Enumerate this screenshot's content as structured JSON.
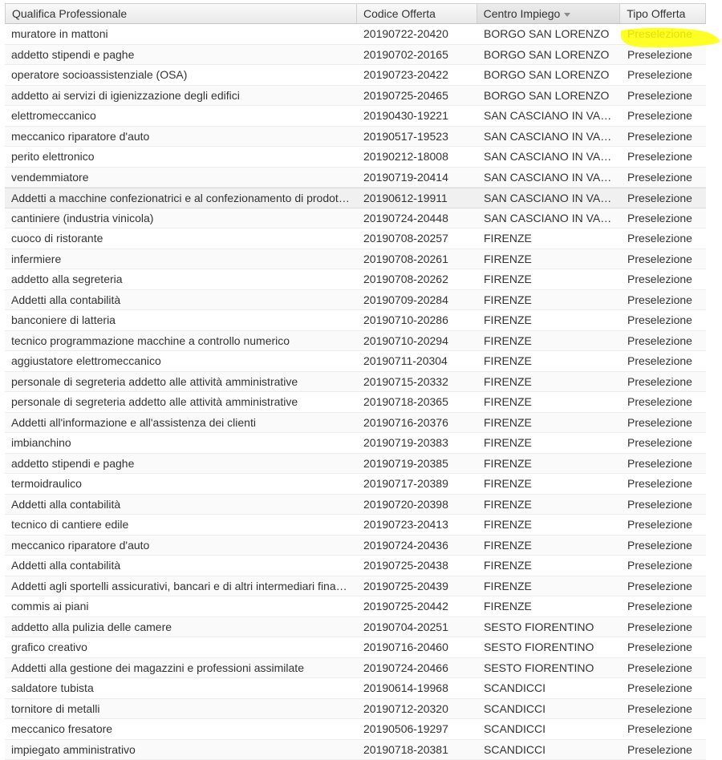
{
  "columns": {
    "qualifica": "Qualifica Professionale",
    "codice": "Codice Offerta",
    "centro": "Centro Impiego",
    "tipo": "Tipo Offerta"
  },
  "sort_column": "Centro Impiego",
  "highlight_color": "#ffff00",
  "rows": [
    {
      "qualifica": "muratore in mattoni",
      "codice": "20190722-20420",
      "centro": "BORGO SAN LORENZO",
      "tipo": "Preselezione"
    },
    {
      "qualifica": "addetto stipendi e paghe",
      "codice": "20190702-20165",
      "centro": "BORGO SAN LORENZO",
      "tipo": "Preselezione"
    },
    {
      "qualifica": "operatore socioassistenziale (OSA)",
      "codice": "20190723-20422",
      "centro": "BORGO SAN LORENZO",
      "tipo": "Preselezione"
    },
    {
      "qualifica": "addetto ai servizi di igienizzazione degli edifici",
      "codice": "20190725-20465",
      "centro": "BORGO SAN LORENZO",
      "tipo": "Preselezione"
    },
    {
      "qualifica": "elettromeccanico",
      "codice": "20190430-19221",
      "centro": "SAN CASCIANO IN VAL…",
      "tipo": "Preselezione"
    },
    {
      "qualifica": "meccanico riparatore d'auto",
      "codice": "20190517-19523",
      "centro": "SAN CASCIANO IN VAL…",
      "tipo": "Preselezione"
    },
    {
      "qualifica": "perito elettronico",
      "codice": "20190212-18008",
      "centro": "SAN CASCIANO IN VAL…",
      "tipo": "Preselezione"
    },
    {
      "qualifica": "vendemmiatore",
      "codice": "20190719-20414",
      "centro": "SAN CASCIANO IN VAL…",
      "tipo": "Preselezione"
    },
    {
      "qualifica": "Addetti a macchine confezionatrici e al confezionamento di prodotti …",
      "codice": "20190612-19911",
      "centro": "SAN CASCIANO IN VAL…",
      "tipo": "Preselezione"
    },
    {
      "qualifica": "cantiniere (industria vinicola)",
      "codice": "20190724-20448",
      "centro": "SAN CASCIANO IN VAL…",
      "tipo": "Preselezione"
    },
    {
      "qualifica": "cuoco di ristorante",
      "codice": "20190708-20257",
      "centro": "FIRENZE",
      "tipo": "Preselezione"
    },
    {
      "qualifica": "infermiere",
      "codice": "20190708-20261",
      "centro": "FIRENZE",
      "tipo": "Preselezione"
    },
    {
      "qualifica": "addetto alla segreteria",
      "codice": "20190708-20262",
      "centro": "FIRENZE",
      "tipo": "Preselezione"
    },
    {
      "qualifica": "Addetti alla contabilità",
      "codice": "20190709-20284",
      "centro": "FIRENZE",
      "tipo": "Preselezione"
    },
    {
      "qualifica": "banconiere di latteria",
      "codice": "20190710-20286",
      "centro": "FIRENZE",
      "tipo": "Preselezione"
    },
    {
      "qualifica": "tecnico programmazione macchine a controllo numerico",
      "codice": "20190710-20294",
      "centro": "FIRENZE",
      "tipo": "Preselezione"
    },
    {
      "qualifica": "aggiustatore elettromeccanico",
      "codice": "20190711-20304",
      "centro": "FIRENZE",
      "tipo": "Preselezione"
    },
    {
      "qualifica": "personale di segreteria addetto alle attività amministrative",
      "codice": "20190715-20332",
      "centro": "FIRENZE",
      "tipo": "Preselezione"
    },
    {
      "qualifica": "personale di segreteria addetto alle attività amministrative",
      "codice": "20190718-20365",
      "centro": "FIRENZE",
      "tipo": "Preselezione"
    },
    {
      "qualifica": "Addetti all'informazione e all'assistenza dei clienti",
      "codice": "20190716-20376",
      "centro": "FIRENZE",
      "tipo": "Preselezione"
    },
    {
      "qualifica": "imbianchino",
      "codice": "20190719-20383",
      "centro": "FIRENZE",
      "tipo": "Preselezione"
    },
    {
      "qualifica": "addetto stipendi e paghe",
      "codice": "20190719-20385",
      "centro": "FIRENZE",
      "tipo": "Preselezione"
    },
    {
      "qualifica": "termoidraulico",
      "codice": "20190717-20389",
      "centro": "FIRENZE",
      "tipo": "Preselezione"
    },
    {
      "qualifica": "Addetti alla contabilità",
      "codice": "20190720-20398",
      "centro": "FIRENZE",
      "tipo": "Preselezione"
    },
    {
      "qualifica": "tecnico di cantiere edile",
      "codice": "20190723-20413",
      "centro": "FIRENZE",
      "tipo": "Preselezione"
    },
    {
      "qualifica": "meccanico riparatore d'auto",
      "codice": "20190724-20436",
      "centro": "FIRENZE",
      "tipo": "Preselezione"
    },
    {
      "qualifica": "Addetti alla contabilità",
      "codice": "20190725-20438",
      "centro": "FIRENZE",
      "tipo": "Preselezione"
    },
    {
      "qualifica": "Addetti agli sportelli assicurativi, bancari e di altri intermediari finan…",
      "codice": "20190725-20439",
      "centro": "FIRENZE",
      "tipo": "Preselezione"
    },
    {
      "qualifica": "commis ai piani",
      "codice": "20190725-20442",
      "centro": "FIRENZE",
      "tipo": "Preselezione"
    },
    {
      "qualifica": "addetto alla pulizia delle camere",
      "codice": "20190704-20251",
      "centro": "SESTO FIORENTINO",
      "tipo": "Preselezione"
    },
    {
      "qualifica": "grafico creativo",
      "codice": "20190716-20460",
      "centro": "SESTO FIORENTINO",
      "tipo": "Preselezione"
    },
    {
      "qualifica": "Addetti alla gestione dei magazzini e professioni assimilate",
      "codice": "20190724-20466",
      "centro": "SESTO FIORENTINO",
      "tipo": "Preselezione"
    },
    {
      "qualifica": "saldatore tubista",
      "codice": "20190614-19968",
      "centro": "SCANDICCI",
      "tipo": "Preselezione"
    },
    {
      "qualifica": "tornitore di metalli",
      "codice": "20190712-20320",
      "centro": "SCANDICCI",
      "tipo": "Preselezione"
    },
    {
      "qualifica": "meccanico fresatore",
      "codice": "20190506-19297",
      "centro": "SCANDICCI",
      "tipo": "Preselezione"
    },
    {
      "qualifica": "impiegato amministrativo",
      "codice": "20190718-20381",
      "centro": "SCANDICCI",
      "tipo": "Preselezione"
    }
  ]
}
